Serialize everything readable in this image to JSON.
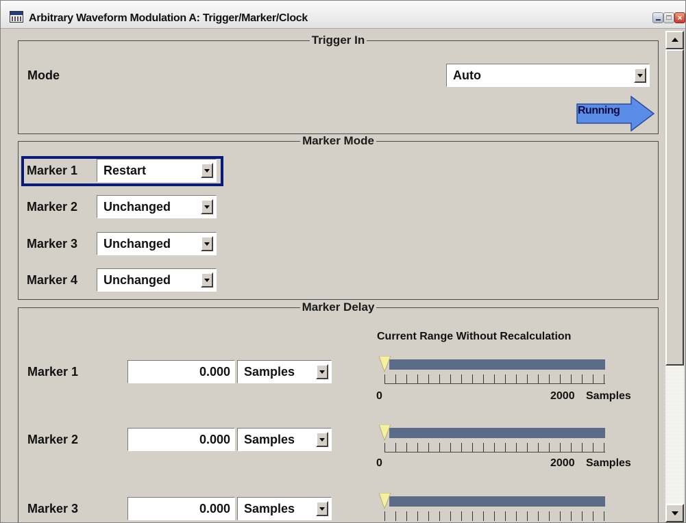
{
  "window": {
    "title": "Arbitrary Waveform Modulation  A: Trigger/Marker/Clock"
  },
  "trigger_in": {
    "group_title": "Trigger In",
    "mode_label": "Mode",
    "mode_value": "Auto",
    "status": "Running"
  },
  "marker_mode": {
    "group_title": "Marker Mode",
    "items": [
      {
        "label": "Marker 1",
        "value": "Restart"
      },
      {
        "label": "Marker 2",
        "value": "Unchanged"
      },
      {
        "label": "Marker 3",
        "value": "Unchanged"
      },
      {
        "label": "Marker 4",
        "value": "Unchanged"
      }
    ]
  },
  "marker_delay": {
    "group_title": "Marker Delay",
    "range_title": "Current Range Without Recalculation",
    "items": [
      {
        "label": "Marker 1",
        "value": "0.000",
        "unit": "Samples",
        "range_min": "0",
        "range_max": "2000",
        "range_unit": "Samples"
      },
      {
        "label": "Marker 2",
        "value": "0.000",
        "unit": "Samples",
        "range_min": "0",
        "range_max": "2000",
        "range_unit": "Samples"
      },
      {
        "label": "Marker 3",
        "value": "0.000",
        "unit": "Samples"
      }
    ]
  },
  "colors": {
    "panel_bg": "#d4d0c8",
    "focus_border": "#0a1a78",
    "status_arrow": "#5a8de8",
    "range_bar": "#5a6b88",
    "range_marker": "#f5f0a0"
  },
  "icons": {
    "app": "waveform-window-icon",
    "minimize": "minimize-icon",
    "maximize": "maximize-icon",
    "close": "close-icon",
    "status": "right-arrow-icon"
  }
}
